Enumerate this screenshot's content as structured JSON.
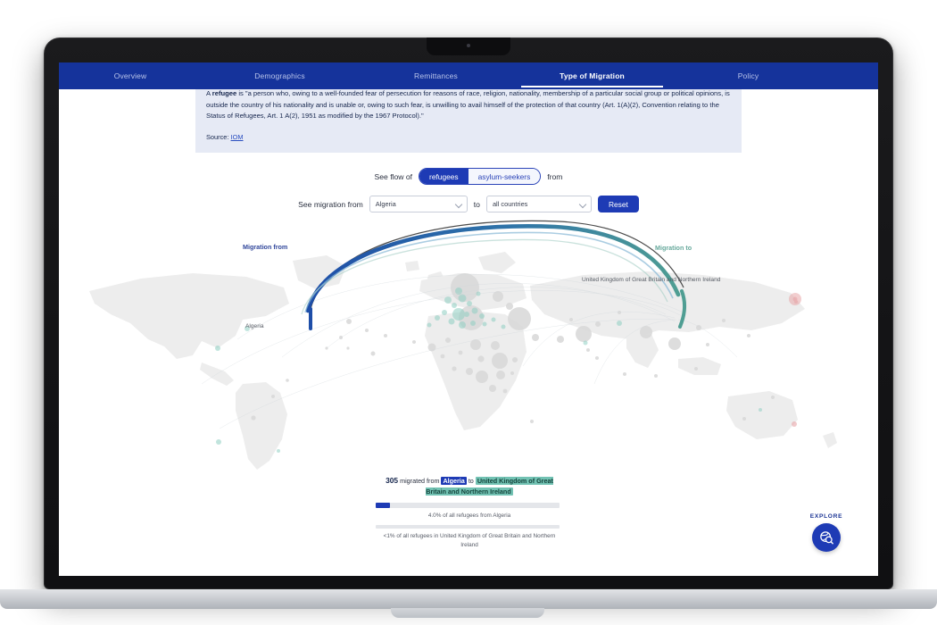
{
  "nav": {
    "tabs": [
      {
        "label": "Overview",
        "active": false
      },
      {
        "label": "Demographics",
        "active": false
      },
      {
        "label": "Remittances",
        "active": false
      },
      {
        "label": "Type of Migration",
        "active": true
      },
      {
        "label": "Policy",
        "active": false
      }
    ]
  },
  "definition": {
    "term": "refugee",
    "lead": "A ",
    "body_line1": " is \"a person who, owing to a well-founded fear of persecution for reasons of race, religion, nationality, membership of a particular social group or",
    "body_line2": "political opinions, is outside the country of his nationality and is unable or, owing to such fear, is unwilling to avail himself of the protection of that country (Art.",
    "body_line3": "1(A)(2), Convention relating to the Status of Refugees, Art. 1 A(2), 1951 as modified by the 1967 Protocol).\"",
    "source_label": "Source:",
    "source_link": "IOM"
  },
  "controls": {
    "flow_prefix": "See flow of",
    "flow_suffix": "from",
    "toggle_options": [
      {
        "label": "refugees",
        "selected": true
      },
      {
        "label": "asylum-seekers",
        "selected": false
      }
    ],
    "migration_prefix": "See migration from",
    "migration_middle": "to",
    "origin_select_value": "Algeria",
    "destination_select_value": "all countries",
    "reset_label": "Reset",
    "caret_icon": "chevron-down-icon"
  },
  "map": {
    "label_from": "Migration from",
    "label_to": "Migration to",
    "origin_country": "Algeria",
    "destination_country": "United Kingdom of Great Britain and Northern Ireland",
    "colors": {
      "origin_arc": "#1e4ea8",
      "destination_arc": "#4f9e93",
      "highlight_arc": "#2b2b2b",
      "landmass": "#ededed"
    }
  },
  "stats": {
    "number": "305",
    "sentence_mid": "migrated from",
    "sentence_to": "to",
    "origin": "Algeria",
    "destination": "United Kingdom of Great Britain and Northern Ireland",
    "bar1_percent": "4.0%",
    "bar1_caption": "4.0% of all refugees from Algeria",
    "bar2_caption": "<1% of all refugees in United Kingdom of Great Britain and Northern Ireland"
  },
  "explore": {
    "label": "EXPLORE",
    "icon": "globe-search-icon"
  }
}
